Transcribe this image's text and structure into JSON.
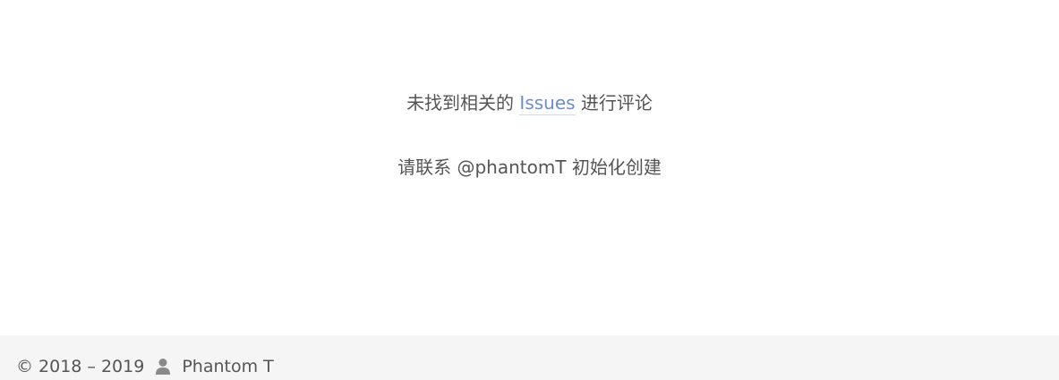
{
  "comments": {
    "line1_prefix": "未找到相关的",
    "line1_link": "Issues",
    "line1_suffix": "进行评论",
    "line2": "请联系 @phantomT 初始化创建"
  },
  "footer": {
    "copyright": "© 2018 – 2019",
    "author_icon": "user-icon",
    "author": "Phantom T"
  },
  "colors": {
    "link": "#6c8ec9",
    "text": "#555555",
    "footer_bg": "#f5f5f5"
  }
}
